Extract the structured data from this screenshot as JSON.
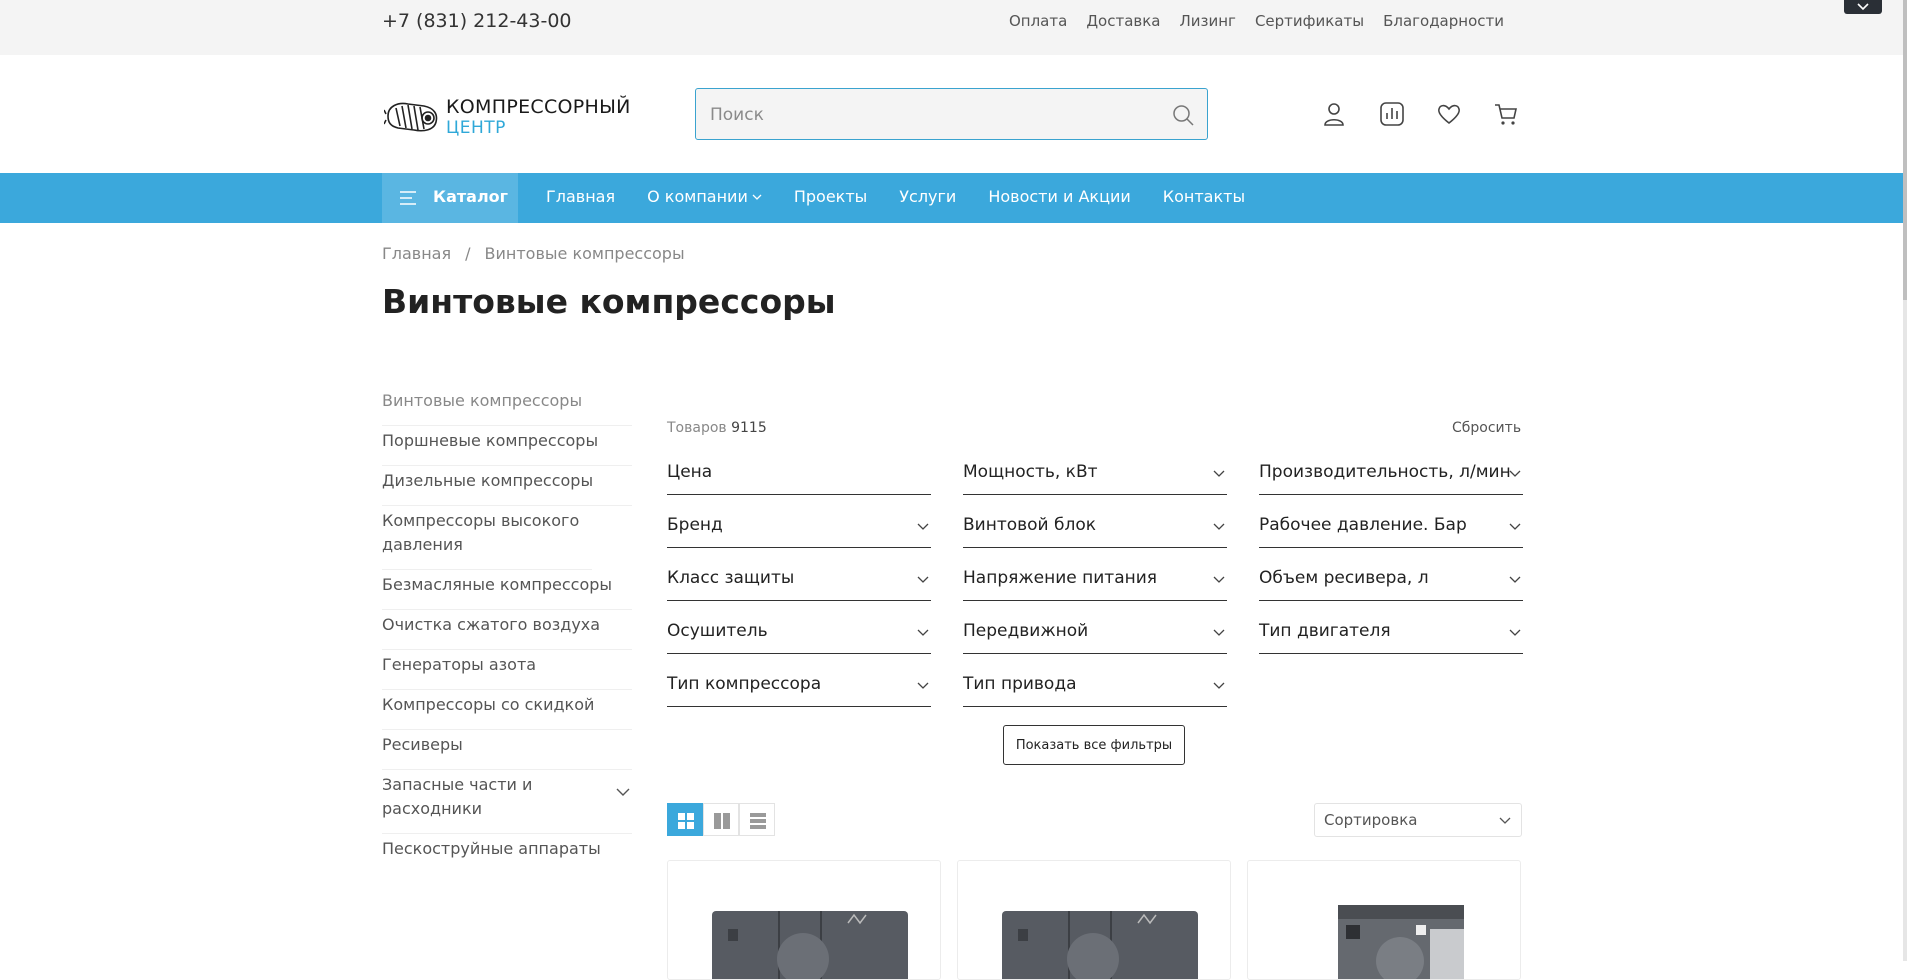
{
  "topbar": {
    "phone": "+7 (831) 212-43-00",
    "links": [
      "Оплата",
      "Доставка",
      "Лизинг",
      "Сертификаты",
      "Благодарности"
    ]
  },
  "header": {
    "logo_line1": "КОМПРЕССОРНЫЙ",
    "logo_line2": "ЦЕНТР",
    "search_placeholder": "Поиск",
    "icons": [
      "user-icon",
      "compare-icon",
      "heart-icon",
      "cart-icon"
    ]
  },
  "nav": {
    "catalog_label": "Каталог",
    "items": [
      "Главная",
      "О компании",
      "Проекты",
      "Услуги",
      "Новости и Акции",
      "Контакты"
    ]
  },
  "breadcrumb": {
    "items": [
      "Главная",
      "Винтовые компрессоры"
    ],
    "separator": "/"
  },
  "page_title": "Винтовые компрессоры",
  "sidebar": {
    "items": [
      "Винтовые компрессоры",
      "Поршневые компрессоры",
      "Дизельные компрессоры",
      "Компрессоры высокого давления",
      "Безмасляные компрессоры",
      "Очистка сжатого воздуха",
      "Генераторы азота",
      "Компрессоры со скидкой",
      "Ресиверы",
      "Запасные части и расходники",
      "Пескоструйные аппараты"
    ]
  },
  "filters": {
    "count_label": "Товаров",
    "count_value": "9115",
    "reset_label": "Сбросить",
    "items": [
      "Цена",
      "Мощность, кВт",
      "Производительность, л/мин",
      "Бренд",
      "Винтовой блок",
      "Рабочее давление. Бар",
      "Класс защиты",
      "Напряжение питания",
      "Объем ресивера, л",
      "Осушитель",
      "Передвижной",
      "Тип двигателя",
      "Тип компрессора",
      "Тип привода"
    ],
    "show_all_label": "Показать все фильтры"
  },
  "listing": {
    "sort_label": "Сортировка"
  },
  "colors": {
    "accent": "#3ba8dc",
    "catalog_bg": "#5ab6e2",
    "topbar_bg": "#f4f4f4"
  }
}
